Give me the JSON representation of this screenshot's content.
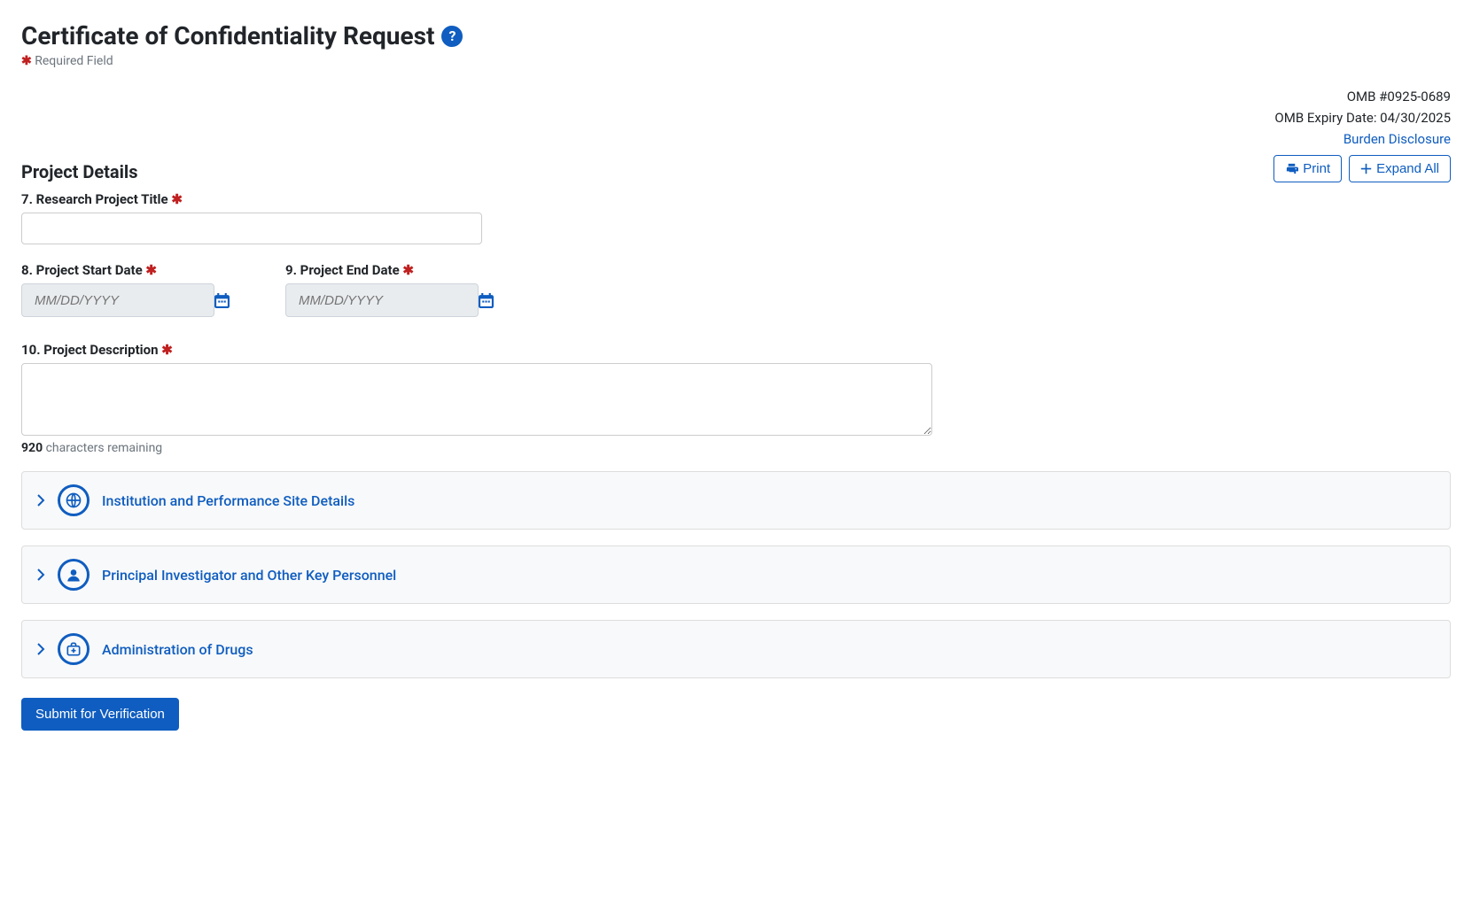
{
  "header": {
    "title": "Certificate of Confidentiality Request",
    "required_note": "Required Field"
  },
  "omb": {
    "number_label": "OMB #0925-0689",
    "expiry_label": "OMB Expiry Date: 04/30/2025",
    "burden_link": "Burden Disclosure"
  },
  "actions": {
    "print": "Print",
    "expand_all": "Expand All"
  },
  "project_details": {
    "heading": "Project Details",
    "fields": {
      "title_label": "7. Research Project Title",
      "title_value": "",
      "start_label": "8. Project Start Date",
      "start_placeholder": "MM/DD/YYYY",
      "start_value": "",
      "end_label": "9. Project End Date",
      "end_placeholder": "MM/DD/YYYY",
      "end_value": "",
      "desc_label": "10. Project Description",
      "desc_value": "",
      "char_count": "920",
      "char_rest": " characters remaining"
    }
  },
  "accordions": [
    {
      "title": "Institution and Performance Site Details"
    },
    {
      "title": "Principal Investigator and Other Key Personnel"
    },
    {
      "title": "Administration of Drugs"
    }
  ],
  "submit": {
    "label": "Submit for Verification"
  }
}
